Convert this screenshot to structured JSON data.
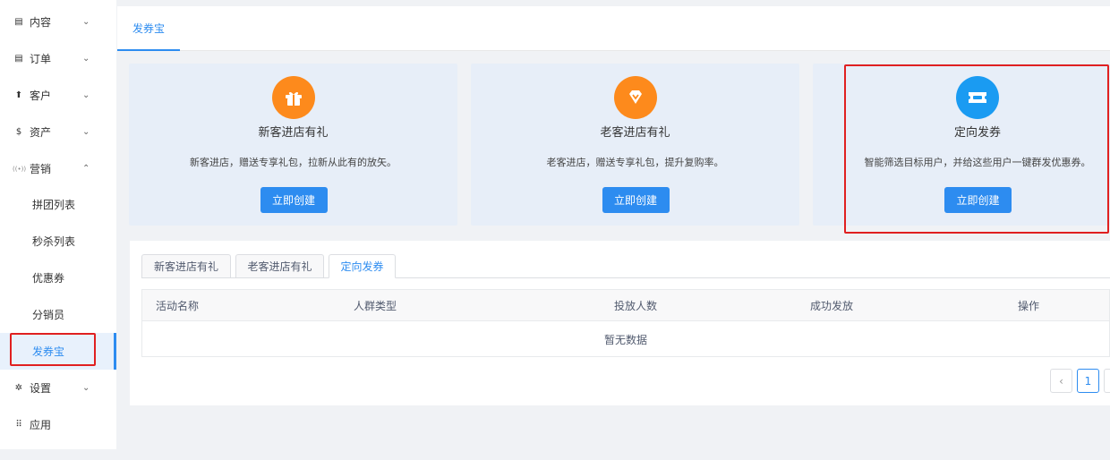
{
  "sidebar": {
    "items": [
      {
        "label": "内容",
        "icon": "document-icon",
        "glyph": "▤",
        "chevron": "⌄"
      },
      {
        "label": "订单",
        "icon": "list-icon",
        "glyph": "▤",
        "chevron": "⌄"
      },
      {
        "label": "客户",
        "icon": "user-icon",
        "glyph": "⬆",
        "chevron": "⌄"
      },
      {
        "label": "资产",
        "icon": "dollar-icon",
        "glyph": "$",
        "chevron": "⌄"
      },
      {
        "label": "营销",
        "icon": "broadcast-icon",
        "glyph": "((•))",
        "chevron": "⌃"
      }
    ],
    "sub_items": [
      {
        "label": "拼团列表"
      },
      {
        "label": "秒杀列表"
      },
      {
        "label": "优惠券"
      },
      {
        "label": "分销员"
      },
      {
        "label": "发券宝"
      }
    ],
    "bottom_items": [
      {
        "label": "设置",
        "icon": "gear-icon",
        "glyph": "✲",
        "chevron": "⌄"
      },
      {
        "label": "应用",
        "icon": "grid-icon",
        "glyph": "⠿"
      }
    ]
  },
  "topbar": {
    "tab_label": "发券宝"
  },
  "cards": [
    {
      "title": "新客进店有礼",
      "desc": "新客进店，赠送专享礼包，拉新从此有的放矢。",
      "button": "立即创建",
      "color": "#fd8a1c",
      "icon": "gift-icon"
    },
    {
      "title": "老客进店有礼",
      "desc": "老客进店，赠送专享礼包，提升复购率。",
      "button": "立即创建",
      "color": "#fd8a1c",
      "icon": "diamond-icon"
    },
    {
      "title": "定向发券",
      "desc": "智能筛选目标用户，并给这些用户一键群发优惠券。",
      "button": "立即创建",
      "color": "#1a9bf2",
      "icon": "ticket-icon"
    }
  ],
  "panel": {
    "tabs": [
      {
        "label": "新客进店有礼"
      },
      {
        "label": "老客进店有礼"
      },
      {
        "label": "定向发券"
      }
    ],
    "columns": [
      "活动名称",
      "人群类型",
      "投放人数",
      "成功发放",
      "操作"
    ],
    "empty_text": "暂无数据",
    "pagination": {
      "prev": "‹",
      "current": "1"
    }
  }
}
